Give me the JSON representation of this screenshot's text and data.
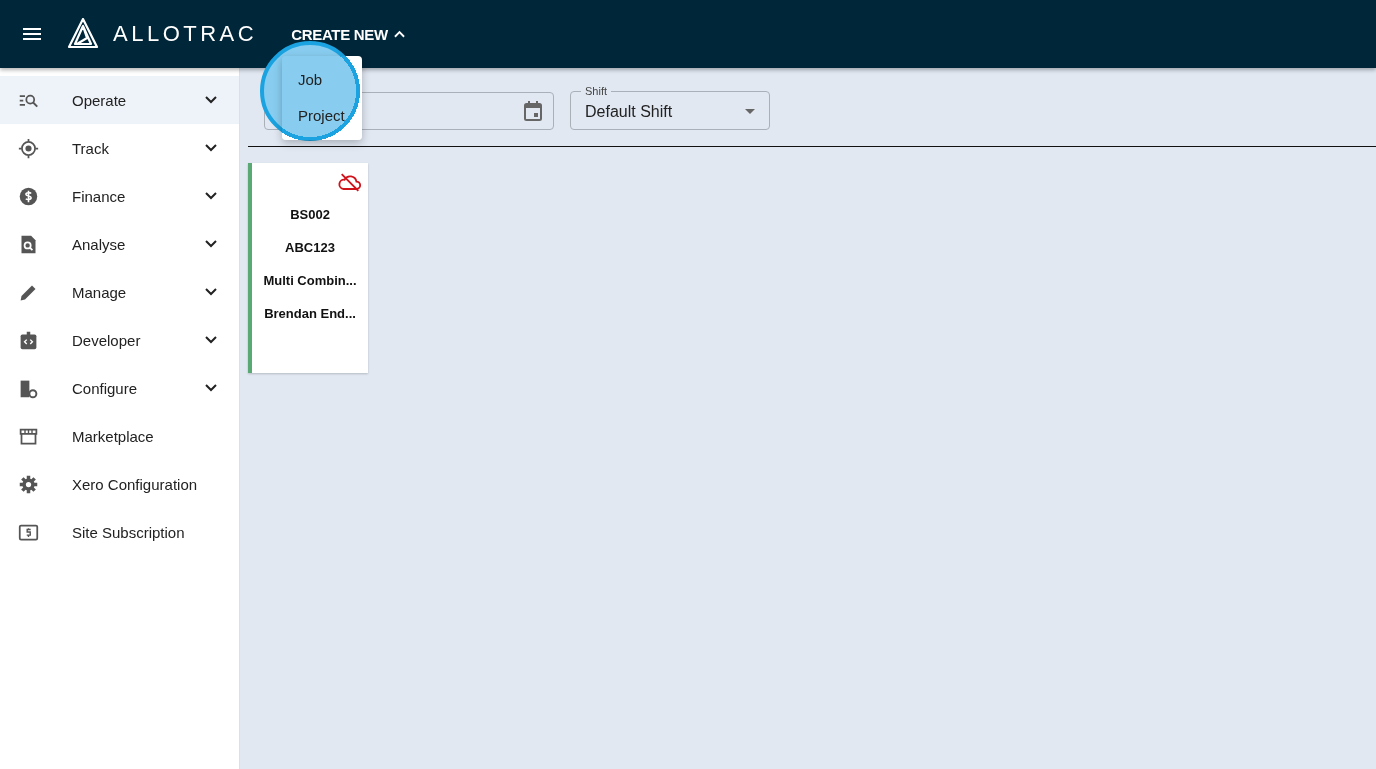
{
  "header": {
    "brand": "ALLOTRAC",
    "create_new": {
      "label": "CREATE NEW",
      "expanded": true,
      "spotlight": true,
      "items": [
        {
          "label": "Job",
          "selected": false
        },
        {
          "label": "Project",
          "selected": false
        }
      ]
    }
  },
  "sidebar": {
    "items": [
      {
        "label": "Operate",
        "expandable": true,
        "selected": true
      },
      {
        "label": "Track",
        "expandable": true,
        "selected": false
      },
      {
        "label": "Finance",
        "expandable": true,
        "selected": false
      },
      {
        "label": "Analyse",
        "expandable": true,
        "selected": false
      },
      {
        "label": "Manage",
        "expandable": true,
        "selected": false
      },
      {
        "label": "Developer",
        "expandable": true,
        "selected": false
      },
      {
        "label": "Configure",
        "expandable": true,
        "selected": false
      },
      {
        "label": "Marketplace",
        "expandable": false,
        "selected": false
      },
      {
        "label": "Xero Configuration",
        "expandable": false,
        "selected": false
      },
      {
        "label": "Site Subscription",
        "expandable": false,
        "selected": false
      }
    ]
  },
  "filters": {
    "shift": {
      "label": "Shift",
      "value": "Default Shift"
    }
  },
  "cards": [
    {
      "lines": [
        "BS002",
        "ABC123",
        "Multi Combin...",
        "Brendan End..."
      ],
      "color": "#5aa874",
      "synced": false
    }
  ]
}
